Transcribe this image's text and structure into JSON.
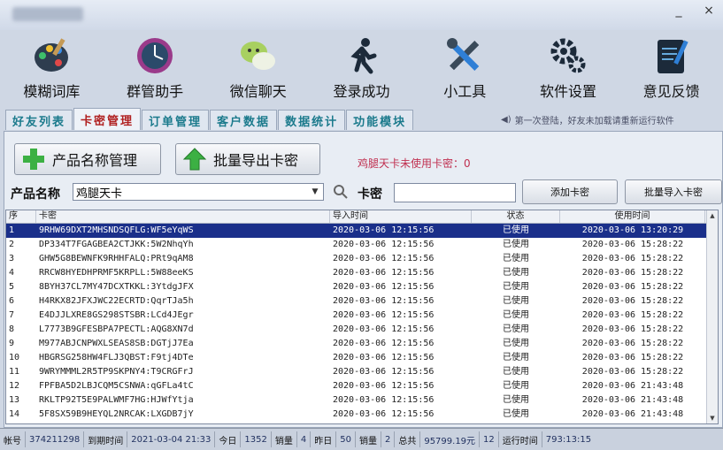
{
  "colors": {
    "accent": "#1a2f8a",
    "tab_active": "#b02020",
    "tab": "#1b7a8c",
    "unused": "#c03050"
  },
  "window": {
    "minimize": "_",
    "close": "×"
  },
  "toolbar": [
    {
      "label": "模糊词库",
      "icon": "palette-icon"
    },
    {
      "label": "群管助手",
      "icon": "clock-icon"
    },
    {
      "label": "微信聊天",
      "icon": "wechat-icon"
    },
    {
      "label": "登录成功",
      "icon": "runner-icon"
    },
    {
      "label": "小工具",
      "icon": "tools-icon"
    },
    {
      "label": "软件设置",
      "icon": "gears-icon"
    },
    {
      "label": "意见反馈",
      "icon": "notepad-icon"
    }
  ],
  "tabs": [
    "好友列表",
    "卡密管理",
    "订单管理",
    "客户数据",
    "数据统计",
    "功能模块"
  ],
  "active_tab": 1,
  "notice": "第一次登陆，好友未加载请重新运行软件",
  "buttons": {
    "product_manage": "产品名称管理",
    "export": "批量导出卡密",
    "add_card": "添加卡密",
    "import": "批量导入卡密"
  },
  "unused_text": "鸡腿天卡未使用卡密：0",
  "product_label": "产品名称",
  "product_value": "鸡腿天卡",
  "card_label": "卡密",
  "table": {
    "headers": [
      "序",
      "卡密",
      "导入时间",
      "状态",
      "使用时间"
    ],
    "selected_row": 0,
    "rows": [
      [
        "1",
        "9RHW69DXT2MHSNDSQFLG:WF5eYqWS",
        "2020-03-06 12:15:56",
        "已使用",
        "2020-03-06 13:20:29"
      ],
      [
        "2",
        "DP334T7FGAGBEA2CTJKK:5W2NhqYh",
        "2020-03-06 12:15:56",
        "已使用",
        "2020-03-06 15:28:22"
      ],
      [
        "3",
        "GHW5G8BEWNFK9RHHFALQ:PRt9qAM8",
        "2020-03-06 12:15:56",
        "已使用",
        "2020-03-06 15:28:22"
      ],
      [
        "4",
        "RRCW8HYEDHPRMF5KRPLL:5W88eeKS",
        "2020-03-06 12:15:56",
        "已使用",
        "2020-03-06 15:28:22"
      ],
      [
        "5",
        "8BYH37CL7MY47DCXTKKL:3YtdgJFX",
        "2020-03-06 12:15:56",
        "已使用",
        "2020-03-06 15:28:22"
      ],
      [
        "6",
        "H4RKX82JFXJWC22ECRTD:QqrTJa5h",
        "2020-03-06 12:15:56",
        "已使用",
        "2020-03-06 15:28:22"
      ],
      [
        "7",
        "E4DJJLXRE8GS298STSBR:LCd4JEgr",
        "2020-03-06 12:15:56",
        "已使用",
        "2020-03-06 15:28:22"
      ],
      [
        "8",
        "L7773B9GFESBPA7PECTL:AQG8XN7d",
        "2020-03-06 12:15:56",
        "已使用",
        "2020-03-06 15:28:22"
      ],
      [
        "9",
        "M977ABJCNPWXLSEAS8SB:DGTjJ7Ea",
        "2020-03-06 12:15:56",
        "已使用",
        "2020-03-06 15:28:22"
      ],
      [
        "10",
        "HBGRSG258HW4FLJ3QBST:F9tj4DTe",
        "2020-03-06 12:15:56",
        "已使用",
        "2020-03-06 15:28:22"
      ],
      [
        "11",
        "9WRYMMML2R5TP9SKPNY4:T9CRGFrJ",
        "2020-03-06 12:15:56",
        "已使用",
        "2020-03-06 15:28:22"
      ],
      [
        "12",
        "FPFBA5D2LBJCQM5CSNWA:qGFLa4tC",
        "2020-03-06 12:15:56",
        "已使用",
        "2020-03-06 21:43:48"
      ],
      [
        "13",
        "RKLTP92T5E9PALWMF7HG:HJWfYtja",
        "2020-03-06 12:15:56",
        "已使用",
        "2020-03-06 21:43:48"
      ],
      [
        "14",
        "5F8SX59B9HEYQL2NRCAK:LXGDB7jY",
        "2020-03-06 12:15:56",
        "已使用",
        "2020-03-06 21:43:48"
      ]
    ]
  },
  "status": {
    "account_label": "帐号",
    "account": "374211298",
    "expire_label": "到期时间",
    "expire": "2021-03-04 21:33",
    "today_label": "今日",
    "today": "1352",
    "sales_label": "销量",
    "sales": "4",
    "yesterday_label": "昨日",
    "yesterday": "50",
    "sales2_label": "销量",
    "sales2": "2",
    "total_label": "总共",
    "total": "95799.19元",
    "count": "12",
    "runtime_label": "运行时间",
    "runtime": "793:13:15"
  }
}
